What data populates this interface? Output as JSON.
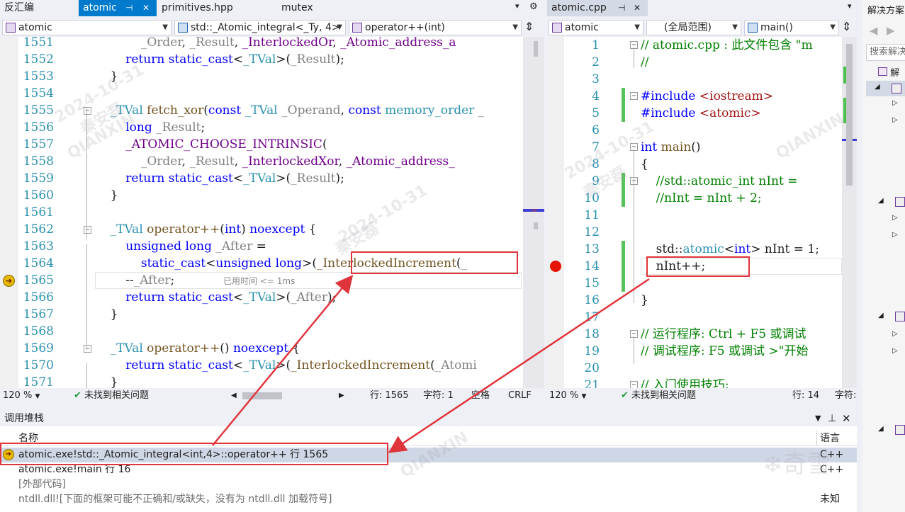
{
  "left_tabs": [
    {
      "label": "反汇编",
      "active": false
    },
    {
      "label": "atomic",
      "active": true
    },
    {
      "label": "primitives.hpp",
      "active": false
    },
    {
      "label": "mutex",
      "active": false
    }
  ],
  "right_tabs": [
    {
      "label": "atomic.cpp",
      "active": true
    }
  ],
  "left_nav": {
    "scope": "atomic",
    "class": "std::_Atomic_integral<_Ty, 4>",
    "member": "operator++(int)"
  },
  "right_nav": {
    "scope": "atomic",
    "range": "(全局范围)",
    "member": "main()"
  },
  "left_lines": [
    {
      "num": "1551",
      "html": "            <span class=\"pm\">_Order</span>, <span class=\"pm\">_Result</span>, <span class=\"mc\">_InterlockedOr</span>, <span class=\"mc\">_Atomic_address_a</span>"
    },
    {
      "num": "1552",
      "html": "        <span class=\"kw\">return</span> <span class=\"kw\">static_cast</span>&lt;<span class=\"ty\">_TVal</span>&gt;(<span class=\"pm\">_Result</span>);"
    },
    {
      "num": "1553",
      "html": "    }"
    },
    {
      "num": "1554",
      "html": ""
    },
    {
      "num": "1555",
      "html": "    <span class=\"ty\">_TVal</span> <span class=\"fn\">fetch_xor</span>(<span class=\"kw\">const</span> <span class=\"ty\">_TVal</span> <span class=\"pm\">_Operand</span>, <span class=\"kw\">const</span> <span class=\"ty\">memory_order</span> <span class=\"pm\">_</span>"
    },
    {
      "num": "1556",
      "html": "        <span class=\"kw\">long</span> <span class=\"pm\">_Result</span>;"
    },
    {
      "num": "1557",
      "html": "        <span class=\"mc\">_ATOMIC_CHOOSE_INTRINSIC</span>("
    },
    {
      "num": "1558",
      "html": "            <span class=\"pm\">_Order</span>, <span class=\"pm\">_Result</span>, <span class=\"mc\">_InterlockedXor</span>, <span class=\"mc\">_Atomic_address_</span>"
    },
    {
      "num": "1559",
      "html": "        <span class=\"kw\">return</span> <span class=\"kw\">static_cast</span>&lt;<span class=\"ty\">_TVal</span>&gt;(<span class=\"pm\">_Result</span>);"
    },
    {
      "num": "1560",
      "html": "    }"
    },
    {
      "num": "1561",
      "html": ""
    },
    {
      "num": "1562",
      "html": "    <span class=\"ty\">_TVal</span> <span class=\"fn\">operator++</span>(<span class=\"kw\">int</span>) <span class=\"kw\">noexcept</span> {"
    },
    {
      "num": "1563",
      "html": "        <span class=\"kw\">unsigned</span> <span class=\"kw\">long</span> <span class=\"pm\">_After</span> ="
    },
    {
      "num": "1564",
      "html": "            <span class=\"kw\">static_cast</span>&lt;<span class=\"kw\">unsigned</span> <span class=\"kw\">long</span>&gt;(<span class=\"fn\">_InterlockedIncrement</span>(<span class=\"pm\">_</span>"
    },
    {
      "num": "1565",
      "html": "        --<span class=\"pm\">_After</span>;"
    },
    {
      "num": "1566",
      "html": "        <span class=\"kw\">return</span> <span class=\"kw\">static_cast</span>&lt;<span class=\"ty\">_TVal</span>&gt;(<span class=\"pm\">_After</span>);"
    },
    {
      "num": "1567",
      "html": "    }"
    },
    {
      "num": "1568",
      "html": ""
    },
    {
      "num": "1569",
      "html": "    <span class=\"ty\">_TVal</span> <span class=\"fn\">operator++</span>() <span class=\"kw\">noexcept</span> {"
    },
    {
      "num": "1570",
      "html": "        <span class=\"kw\">return</span> <span class=\"kw\">static_cast</span>&lt;<span class=\"ty\">_TVal</span>&gt;(<span class=\"fn\">_InterlockedIncrement</span>(<span class=\"pm\">_Atomi</span>"
    },
    {
      "num": "1571",
      "html": "    }"
    }
  ],
  "elapsed_hint": "已用时间 <= 1ms",
  "right_lines": [
    {
      "num": "1",
      "html": "<span class=\"cm\">// atomic.cpp : 此文件包含 \"m</span>"
    },
    {
      "num": "2",
      "html": "<span class=\"cm\">//</span>"
    },
    {
      "num": "3",
      "html": ""
    },
    {
      "num": "4",
      "html": "<span class=\"kw\">#include</span> <span class=\"st\">&lt;iostream&gt;</span>"
    },
    {
      "num": "5",
      "html": "<span class=\"kw\">#include</span> <span class=\"st\">&lt;atomic&gt;</span>"
    },
    {
      "num": "6",
      "html": ""
    },
    {
      "num": "7",
      "html": "<span class=\"kw\">int</span> <span class=\"fn\">main</span>()"
    },
    {
      "num": "8",
      "html": "{"
    },
    {
      "num": "9",
      "html": "    <span class=\"cm\">//std::atomic_int nInt =</span>"
    },
    {
      "num": "10",
      "html": "    <span class=\"cm\">//nInt = nInt + 2;</span>"
    },
    {
      "num": "11",
      "html": ""
    },
    {
      "num": "12",
      "html": ""
    },
    {
      "num": "13",
      "html": "    std::<span class=\"ty\">atomic</span>&lt;<span class=\"kw\">int</span>&gt; nInt = 1;"
    },
    {
      "num": "14",
      "html": "    nInt++;"
    },
    {
      "num": "15",
      "html": ""
    },
    {
      "num": "16",
      "html": "}"
    },
    {
      "num": "17",
      "html": ""
    },
    {
      "num": "18",
      "html": "<span class=\"cm\">// 运行程序: Ctrl + F5 或调试</span>"
    },
    {
      "num": "19",
      "html": "<span class=\"cm\">// 调试程序: F5 或调试 &gt;\"开始</span>"
    },
    {
      "num": "20",
      "html": ""
    },
    {
      "num": "21",
      "html": "<span class=\"cm\">// 入门使用技巧:</span>"
    }
  ],
  "left_status": {
    "zoom": "120 %",
    "issues": "未找到相关问题",
    "line": "行: 1565",
    "char": "字符: 1",
    "space": "空格",
    "eol": "CRLF"
  },
  "right_status": {
    "zoom": "120 %",
    "issues": "未找到相关问题",
    "line": "行: 14",
    "char": "字符:"
  },
  "callstack": {
    "title": "调用堆栈",
    "col_name": "名称",
    "col_lang": "语言",
    "rows": [
      {
        "name": "atomic.exe!std::_Atomic_integral<int,4>::operator++ 行 1565",
        "lang": "C++",
        "current": true
      },
      {
        "name": "atomic.exe!main 行 16",
        "lang": "C++",
        "current": false
      },
      {
        "name": "[外部代码]",
        "lang": "",
        "current": false
      },
      {
        "name": "ntdll.dll![下面的框架可能不正确和/或缺失，没有为 ntdll.dll 加载符号]",
        "lang": "未知",
        "current": false
      }
    ]
  },
  "solution": {
    "title": "解决方案",
    "search_placeholder": "搜索解决",
    "root_label": "解"
  },
  "watermark_date": "2024-10-31",
  "watermark_name": "秦安磊",
  "watermark_org": "QIANXIN",
  "watermark_brand": "奇雪"
}
